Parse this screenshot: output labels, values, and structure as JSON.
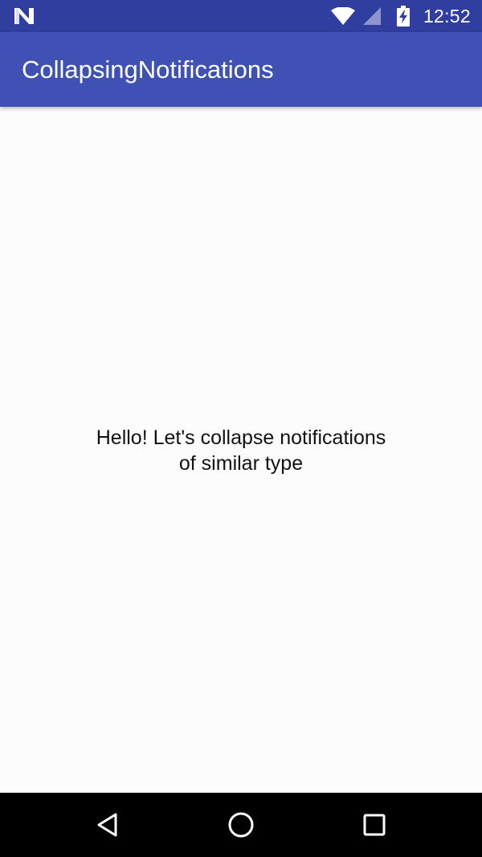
{
  "status_bar": {
    "time": "12:52",
    "icons": [
      "n-logo-icon",
      "wifi-icon",
      "signal-icon",
      "battery-charging-icon"
    ]
  },
  "app_bar": {
    "title": "CollapsingNotifications"
  },
  "main": {
    "message_line1": "Hello! Let's collapse notifications",
    "message_line2": "of similar type"
  },
  "nav_bar": {
    "buttons": [
      "back-icon",
      "home-icon",
      "recents-icon"
    ]
  },
  "colors": {
    "status_bar": "#303f9f",
    "app_bar": "#3f51b5",
    "background": "#fdfcfd",
    "nav_bar": "#000000"
  }
}
